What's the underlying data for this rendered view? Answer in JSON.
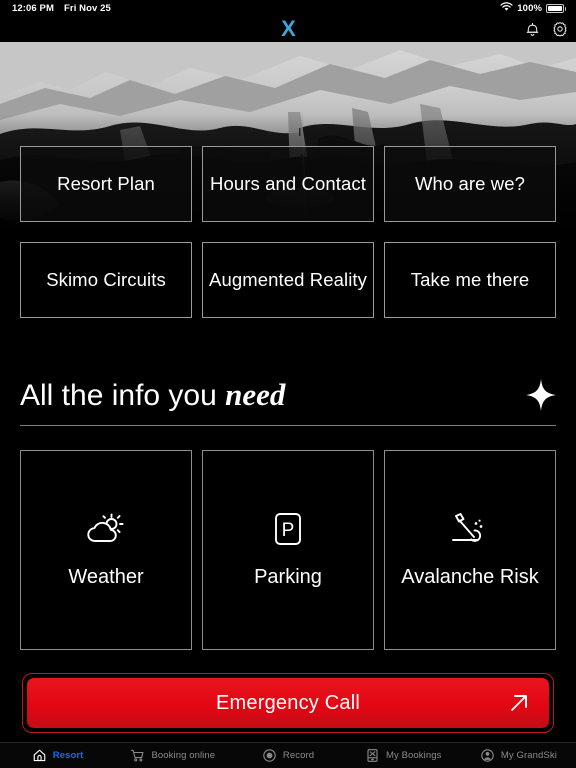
{
  "status_bar": {
    "time": "12:06 PM",
    "date": "Fri Nov 25",
    "battery_percent": "100%",
    "wifi_icon": "wifi-icon",
    "battery_icon": "battery-full-icon"
  },
  "app_bar": {
    "logo_text": "X",
    "logo_color": "#38a9dd",
    "notifications_icon": "bell-icon",
    "settings_icon": "gear-icon"
  },
  "hero": {
    "alt": "ski-resort-mountain-panorama"
  },
  "quick_actions": {
    "row1": [
      {
        "label": "Resort Plan",
        "name": "resort-plan"
      },
      {
        "label": "Hours and Contact",
        "name": "hours-and-contact"
      },
      {
        "label": "Who are we?",
        "name": "who-are-we"
      }
    ],
    "row2": [
      {
        "label": "Skimo Circuits",
        "name": "skimo-circuits"
      },
      {
        "label": "Augmented Reality",
        "name": "augmented-reality"
      },
      {
        "label": "Take me there",
        "name": "take-me-there"
      }
    ]
  },
  "info_section": {
    "title_plain": "All the info you ",
    "title_emphasis": "need",
    "star_icon": "sparkle-star-icon",
    "cards": [
      {
        "label": "Weather",
        "icon": "cloud-sun-icon",
        "name": "weather"
      },
      {
        "label": "Parking",
        "icon": "parking-p-icon",
        "name": "parking"
      },
      {
        "label": "Avalanche Risk",
        "icon": "avalanche-icon",
        "name": "avalanche-risk"
      }
    ]
  },
  "emergency": {
    "label": "Emergency Call",
    "arrow_icon": "arrow-up-right-icon",
    "color": "#e30613",
    "border_color": "#c1171b"
  },
  "tab_bar": {
    "active_color": "#0a6ff0",
    "inactive_color": "#8b8b8b",
    "tabs": [
      {
        "label": "Resort",
        "icon": "home-icon",
        "name": "resort",
        "active": true
      },
      {
        "label": "Booking online",
        "icon": "cart-icon",
        "name": "booking-online",
        "active": false
      },
      {
        "label": "Record",
        "icon": "record-icon",
        "name": "record",
        "active": false
      },
      {
        "label": "My Bookings",
        "icon": "ticket-icon",
        "name": "my-bookings",
        "active": false
      },
      {
        "label": "My GrandSki",
        "icon": "account-icon",
        "name": "my-grandski",
        "active": false
      }
    ]
  }
}
